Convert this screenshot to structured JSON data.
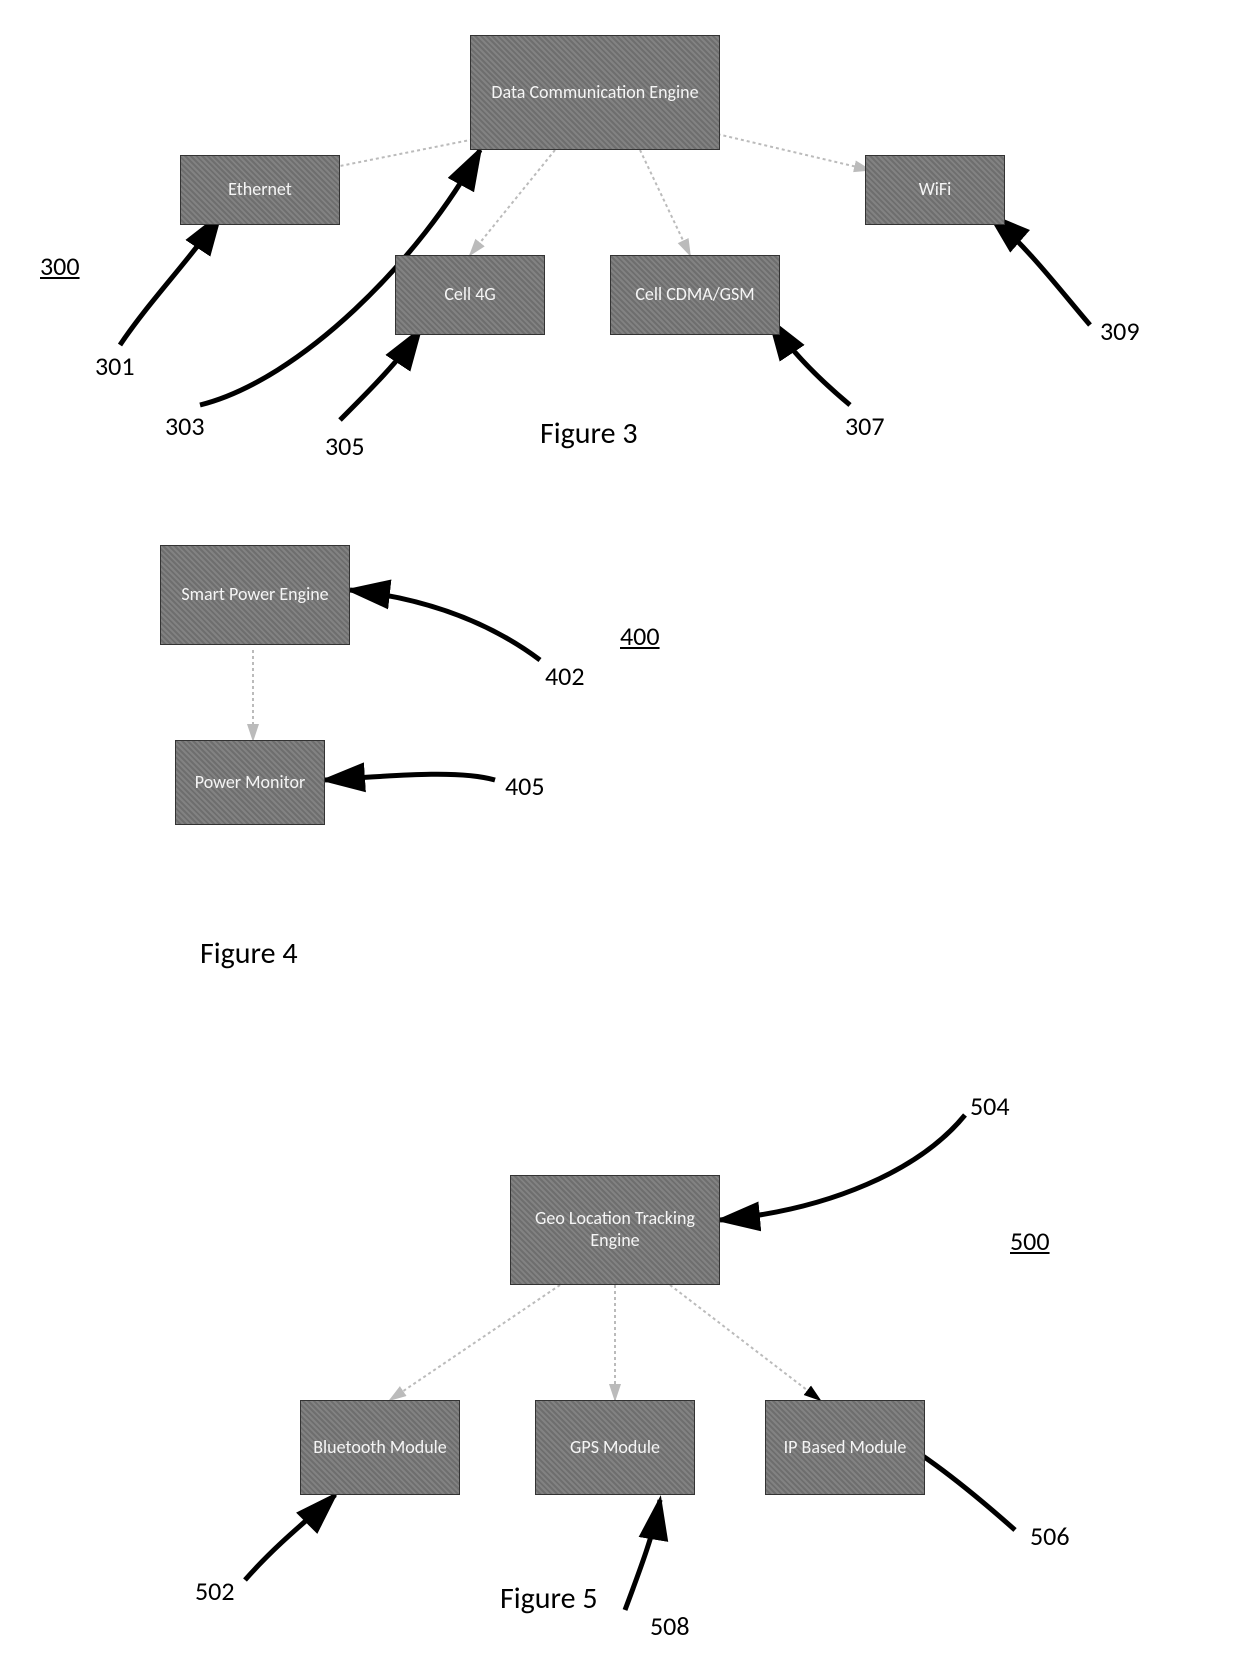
{
  "fig3": {
    "id": "300",
    "caption": "Figure 3",
    "engine": "Data Communication Engine",
    "ethernet": "Ethernet",
    "cell4g": "Cell 4G",
    "cellcdma": "Cell CDMA/GSM",
    "wifi": "WiFi",
    "ref301": "301",
    "ref303": "303",
    "ref305": "305",
    "ref307": "307",
    "ref309": "309"
  },
  "fig4": {
    "id": "400",
    "caption": "Figure 4",
    "engine": "Smart Power Engine",
    "monitor": "Power Monitor",
    "ref402": "402",
    "ref405": "405"
  },
  "fig5": {
    "id": "500",
    "caption": "Figure 5",
    "engine": "Geo Location Tracking Engine",
    "bluetooth": "Bluetooth Module",
    "gps": "GPS Module",
    "ip": "IP Based Module",
    "ref502": "502",
    "ref504": "504",
    "ref506": "506",
    "ref508": "508"
  }
}
